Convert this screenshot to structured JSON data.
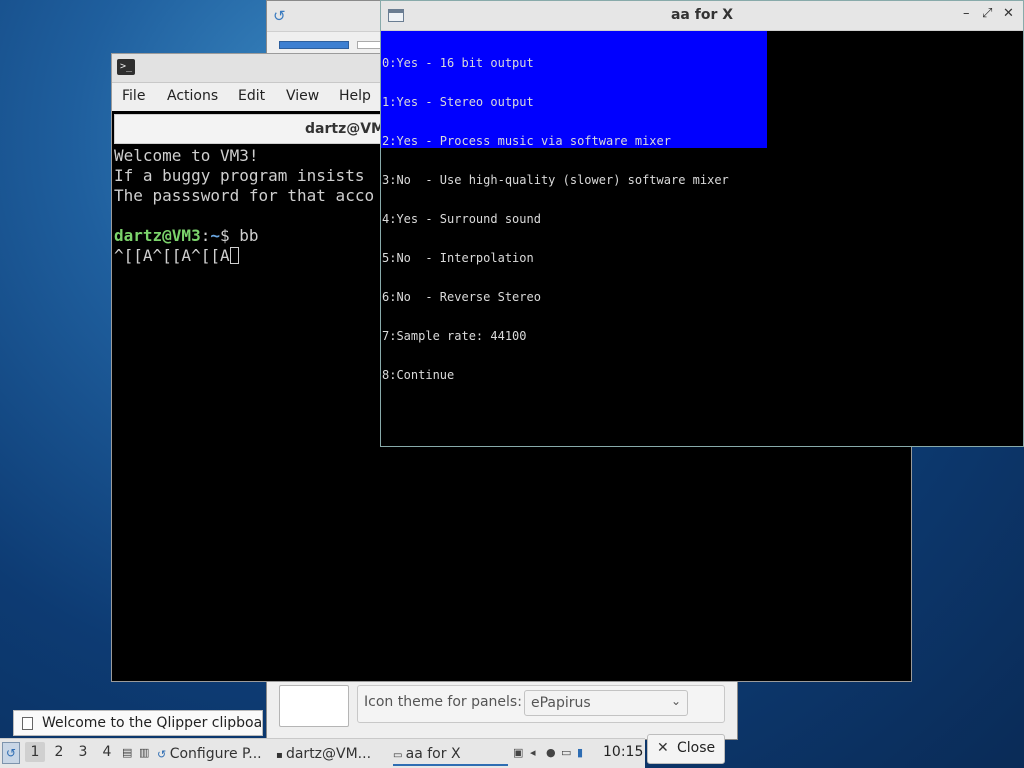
{
  "config_window": {
    "icon_theme_label": "Icon theme for panels:",
    "icon_theme_value": "ePapirus"
  },
  "terminal": {
    "menu": [
      "File",
      "Actions",
      "Edit",
      "View",
      "Help"
    ],
    "tab_title": "dartz@VM3",
    "lines": [
      "Welcome to VM3!",
      "If a buggy program insists",
      "The passsword for that acco"
    ],
    "prompt_user": "dartz@VM3",
    "prompt_sep": ":",
    "prompt_path": "~",
    "prompt_cmd": "$ bb",
    "input_line": "^[[A^[[A^[[A"
  },
  "aa_window": {
    "title": "aa for X",
    "controls": [
      "–",
      "⤢",
      "✕"
    ],
    "options": [
      "0:Yes - 16 bit output",
      "1:Yes - Stereo output",
      "2:Yes - Process music via software mixer",
      "3:No  - Use high-quality (slower) software mixer",
      "4:Yes - Surround sound",
      "5:No  - Interpolation",
      "6:No  - Reverse Stereo",
      "7:Sample rate: 44100",
      "8:Continue"
    ]
  },
  "notification": {
    "text": "Welcome to the Qlipper clipboa"
  },
  "close_button": {
    "label": "Close"
  },
  "taskbar": {
    "workspaces": [
      "1",
      "2",
      "3",
      "4"
    ],
    "tasks": [
      {
        "icon": "config-icon",
        "label": "Configure P..."
      },
      {
        "icon": "terminal-icon",
        "label": "dartz@VM..."
      },
      {
        "icon": "window-icon",
        "label": "aa for X"
      }
    ],
    "clock": "10:15"
  },
  "colors": {
    "aa_highlight": "#0000ff",
    "prompt_green": "#7bd36b",
    "prompt_blue": "#6ba8e3"
  }
}
